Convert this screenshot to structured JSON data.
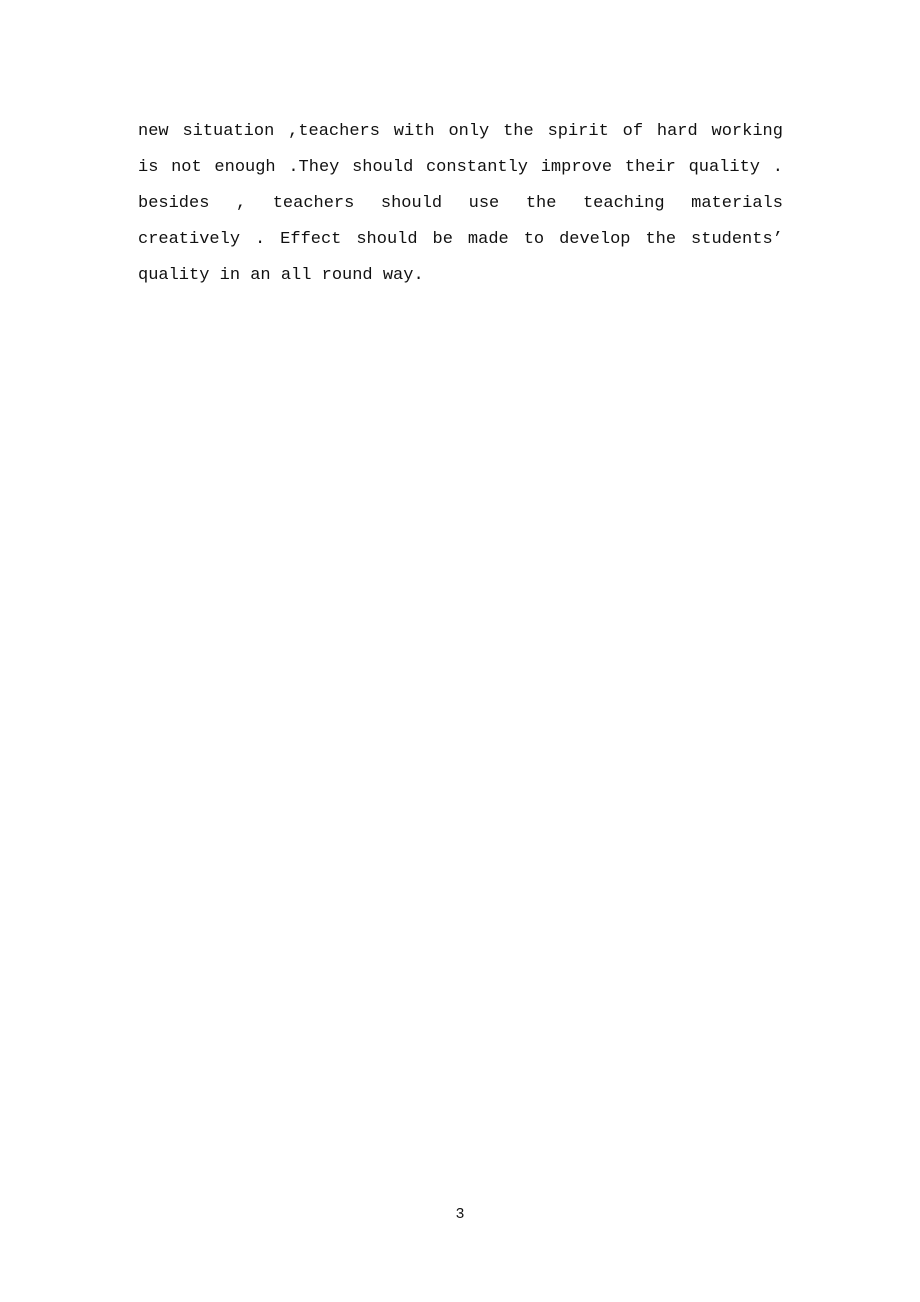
{
  "document": {
    "page_number": "3",
    "body": {
      "lines": [
        {
          "id": "line-1",
          "justified": true,
          "text": "new situation ,teachers with only the spirit of hard working",
          "tokens": [
            "new",
            "situation",
            ",teachers",
            "with",
            "only",
            "the",
            "spirit",
            "of",
            "hard",
            "working"
          ]
        },
        {
          "id": "line-2",
          "justified": true,
          "text": "is not enough .They should constantly improve their quality .",
          "tokens": [
            "is",
            "not",
            "enough",
            ".They",
            "should",
            "constantly",
            "improve",
            "their",
            "quality",
            "."
          ]
        },
        {
          "id": "line-3",
          "justified": true,
          "text": "besides , teachers should use the teaching materials",
          "tokens": [
            "besides",
            ",",
            "teachers",
            "should",
            "use",
            "the",
            "teaching",
            "materials"
          ]
        },
        {
          "id": "line-4",
          "justified": true,
          "text": "creatively . Effect should be made to develop the students’",
          "tokens": [
            "creatively",
            ".",
            "Effect",
            "should",
            "be",
            "made",
            "to",
            "develop",
            "the",
            "students’"
          ]
        },
        {
          "id": "line-5",
          "justified": false,
          "text": "quality in an all round way.",
          "tokens": [
            "quality",
            "in",
            "an",
            "all",
            "round",
            "way."
          ]
        }
      ],
      "full_text": "new situation ,teachers with only the spirit of hard working is not enough .They should constantly improve their quality . besides , teachers should use the teaching materials creatively . Effect should be made to develop the students’ quality in an all round way."
    },
    "colors": {
      "page_background": "#ffffff",
      "text": "#111111"
    }
  }
}
